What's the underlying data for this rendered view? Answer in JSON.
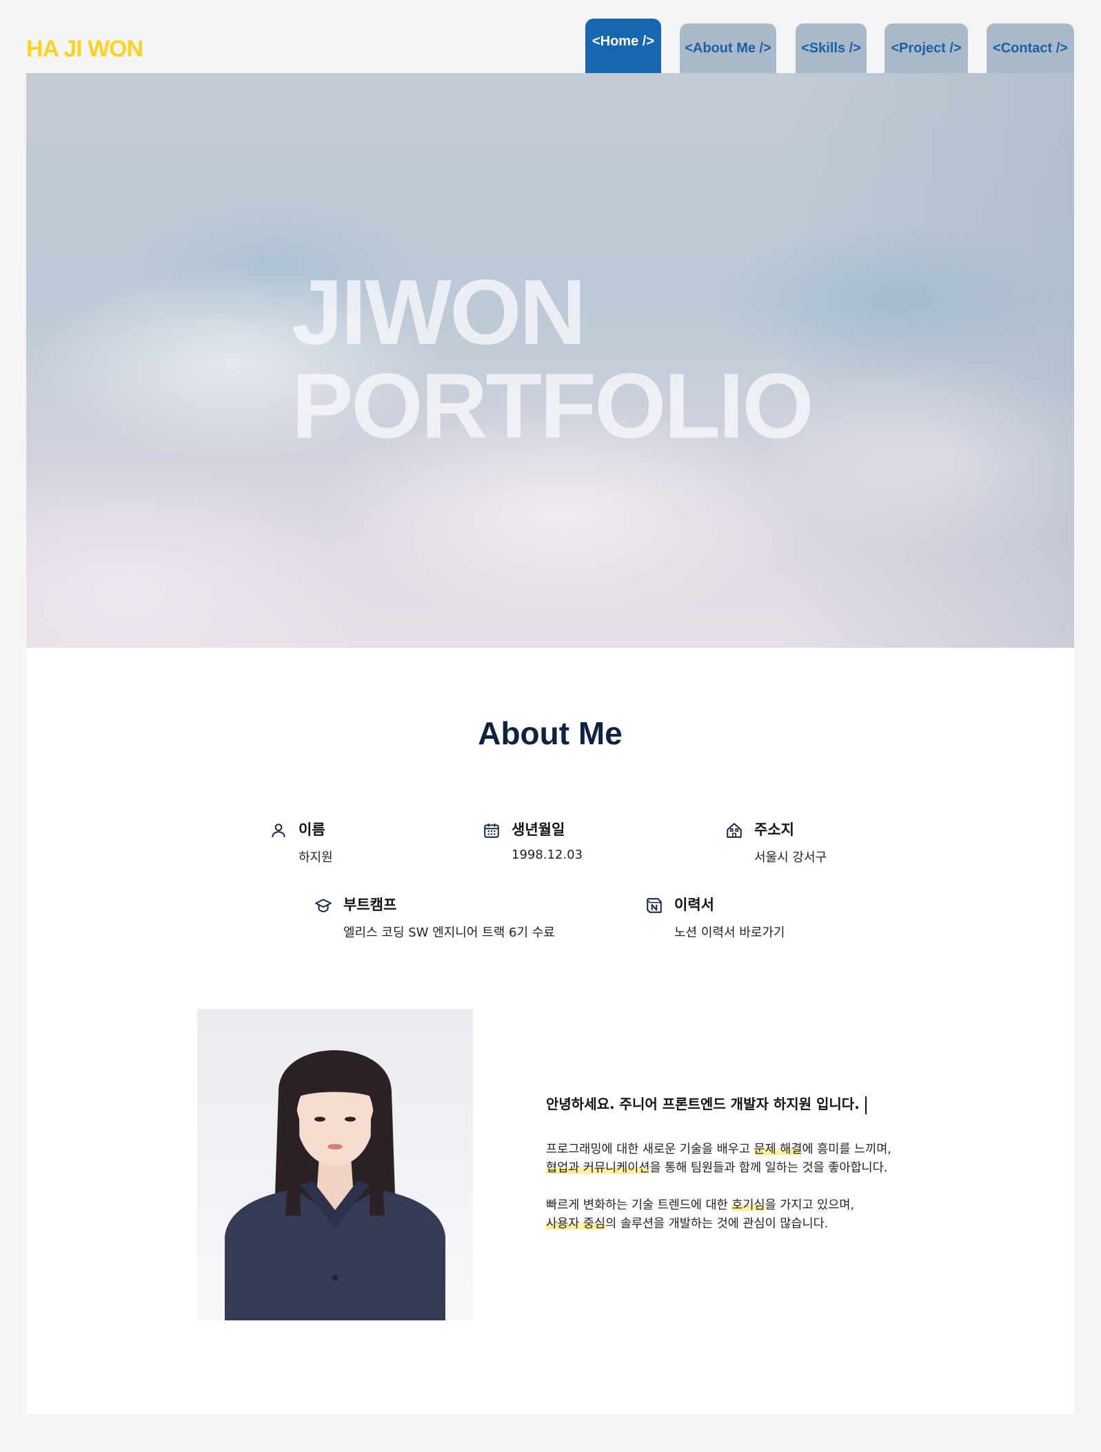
{
  "header": {
    "logo": "HA JI WON",
    "tabs": [
      {
        "label": "<Home />",
        "active": true
      },
      {
        "label": "<About Me />",
        "active": false
      },
      {
        "label": "<Skills />",
        "active": false
      },
      {
        "label": "<Project />",
        "active": false
      },
      {
        "label": "<Contact />",
        "active": false
      }
    ]
  },
  "hero": {
    "line1": "JIWON",
    "line2": "PORTFOLIO"
  },
  "about": {
    "title": "About Me",
    "info": [
      {
        "icon": "user-icon",
        "label": "이름",
        "value": "하지원"
      },
      {
        "icon": "calendar-icon",
        "label": "생년월일",
        "value": "1998.12.03"
      },
      {
        "icon": "building-icon",
        "label": "주소지",
        "value": "서울시 강서구"
      },
      {
        "icon": "graduation-cap-icon",
        "label": "부트캠프",
        "value": "엘리스 코딩 SW 엔지니어 트랙 6기 수료"
      },
      {
        "icon": "notion-icon",
        "label": "이력서",
        "value": "노션 이력서 바로가기"
      }
    ],
    "greeting": "안녕하세요. 주니어 프론트엔드 개발자 하지원 입니다.",
    "paragraph1": {
      "a": "프로그래밍에 대한 새로운 기술을 배우고 ",
      "hl1": "문제 해결",
      "b": "에 흥미를 느끼며,",
      "hl2": "협업과 커뮤니케이션",
      "c": "을 통해 팀원들과 함께 일하는 것을 좋아합니다."
    },
    "paragraph2": {
      "a": "빠르게 변화하는 기술 트렌드에 대한 ",
      "hl1": "호기심",
      "b": "을 가지고 있으며,",
      "hl2": "사용자 중심",
      "c": "의 솔루션을 개발하는 것에 관심이 많습니다."
    }
  },
  "colors": {
    "logo": "#ffd21f",
    "active_tab": "#1766b0",
    "inactive_tab": "#a9b9c8",
    "tab_text": "#1a5fa8",
    "title": "#0e2340",
    "highlight": "#fff0a0"
  }
}
